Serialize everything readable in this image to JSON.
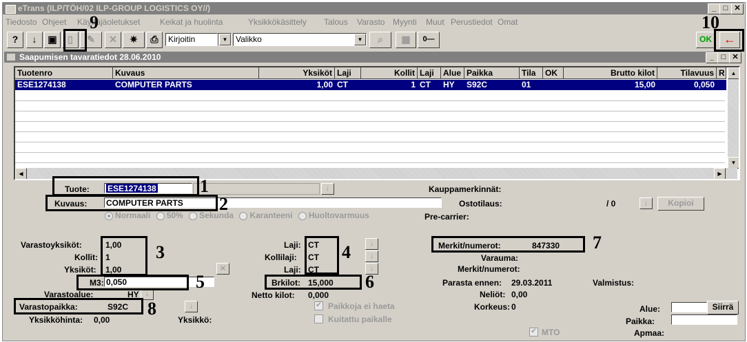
{
  "window": {
    "title": "eTrans  (ILP/TÖH/02 ILP-GROUP LOGISTICS OY//)",
    "minimize": "_",
    "restore": "□",
    "close": "✕"
  },
  "menu": [
    "Tiedosto",
    "Ohjeet",
    "Käyttäjäoletukset",
    "Keikat ja huolinta",
    "Yksikkökäsittely",
    "Talous",
    "Varasto",
    "Myynti",
    "Muut",
    "Perustiedot",
    "Omat"
  ],
  "toolbar": {
    "printer_combo": "Kirjoitin",
    "menu_combo": "Valikko",
    "ok_label": "OK",
    "back_glyph": "←",
    "key_glyph": "0—"
  },
  "subwindow": {
    "title": "Saapumisen tavaratiedot 28.06.2010"
  },
  "grid": {
    "headers": [
      "Tuotenro",
      "Kuvaus",
      "Yksiköt",
      "Laji",
      "Kollit",
      "Laji",
      "Alue",
      "Paikka",
      "Tila",
      "OK",
      "Brutto kilot",
      "Tilavuus",
      "R"
    ],
    "rows": [
      [
        "ESE1274138",
        "COMPUTER PARTS",
        "1,00",
        "CT",
        "1",
        "CT",
        "HY",
        "S92C",
        "01",
        "",
        "15,00",
        "0,050",
        ""
      ]
    ]
  },
  "form": {
    "tuote_label": "Tuote:",
    "tuote_value": "ESE1274138",
    "kuvaus_label": "Kuvaus:",
    "kuvaus_value": "COMPUTER PARTS",
    "kauppamerkinnat_label": "Kauppamerkinnät:",
    "ostotilaus_label": "Ostotilaus:",
    "ostotilaus_value": "/ 0",
    "kopioi_label": "Kopioi",
    "precarrier_label": "Pre-carrier:",
    "radios": [
      "Normaali",
      "50%",
      "Sekunda",
      "Karanteeni",
      "Huoltovarmuus"
    ],
    "varastoyksikot_label": "Varastoyksiköt:",
    "varastoyksikot_value": "1,00",
    "kollit_label": "Kollit:",
    "kollit_value": "1",
    "yksikot_label": "Yksiköt:",
    "yksikot_value": "1,00",
    "m3_label": "M3:",
    "m3_value": "0,050",
    "varastoalue_label": "Varastoalue:",
    "varastoalue_value": "HY",
    "varastopaikka_label": "Varastopaikka:",
    "varastopaikka_value": "S92C",
    "yksikkohinta_label": "Yksikköhinta:",
    "yksikkohinta_value": "0,00",
    "yksikko_label": "Yksikkö:",
    "laji_label": "Laji:",
    "laji_value": "CT",
    "kollilaji_label": "Kollilaji:",
    "kollilaji_value": "CT",
    "laji2_label": "Laji:",
    "laji2_value": "CT",
    "brkilot_label": "Brkilot:",
    "brkilot_value": "15,000",
    "nettokilot_label": "Netto kilot:",
    "nettokilot_value": "0,000",
    "paikkoja_label": "Paikkoja ei haeta",
    "kuitattu_label": "Kuitattu paikalle",
    "merkit_label": "Merkit/numerot:",
    "merkit_value": "847330",
    "varauma_label": "Varauma:",
    "merkit2_label": "Merkit/numerot:",
    "parasta_label": "Parasta ennen:",
    "parasta_value": "29.03.2011",
    "valmistus_label": "Valmistus:",
    "neliot_label": "Neliöt:",
    "neliot_value": "0,00",
    "korkeus_label": "Korkeus:",
    "korkeus_value": "0",
    "alue_label": "Alue:",
    "siirra_label": "Siirrä",
    "paikka_label": "Paikka:",
    "apmaa_label": "Apmaa:",
    "mto_label": "MTO"
  },
  "annotations": [
    "1",
    "2",
    "3",
    "4",
    "5",
    "6",
    "7",
    "8",
    "9",
    "10"
  ]
}
